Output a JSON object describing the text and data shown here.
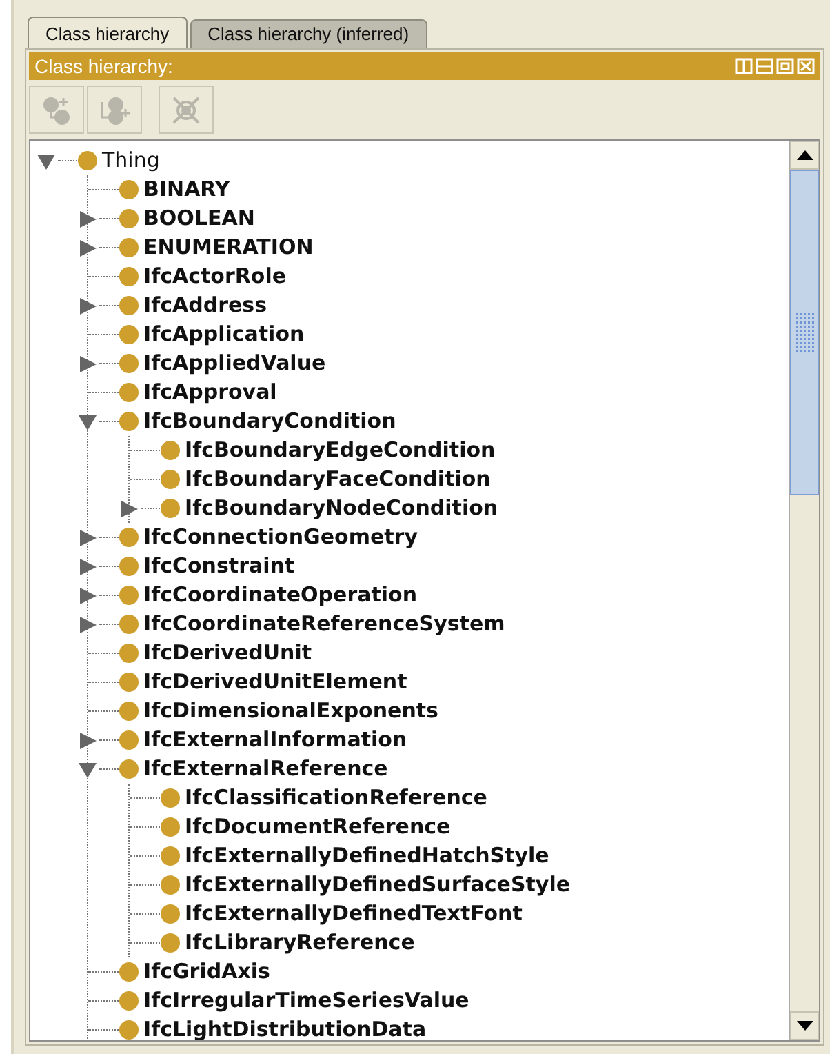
{
  "tabs": [
    {
      "label": "Class hierarchy",
      "selected": true
    },
    {
      "label": "Class hierarchy (inferred)",
      "selected": false
    }
  ],
  "panel": {
    "title": "Class hierarchy:"
  },
  "toolbar": [
    {
      "kind": "add-subclass",
      "disabled": true
    },
    {
      "kind": "add-sibling",
      "disabled": true
    },
    {
      "kind": "delete",
      "disabled": true
    }
  ],
  "tree": [
    {
      "label": "Thing",
      "bold": false,
      "kind": "expanded",
      "children": [
        {
          "label": "BINARY",
          "bold": true,
          "kind": "leaf"
        },
        {
          "label": "BOOLEAN",
          "bold": true,
          "kind": "collapsed"
        },
        {
          "label": "ENUMERATION",
          "bold": true,
          "kind": "collapsed"
        },
        {
          "label": "IfcActorRole",
          "bold": true,
          "kind": "leaf"
        },
        {
          "label": "IfcAddress",
          "bold": true,
          "kind": "collapsed"
        },
        {
          "label": "IfcApplication",
          "bold": true,
          "kind": "leaf"
        },
        {
          "label": "IfcAppliedValue",
          "bold": true,
          "kind": "collapsed"
        },
        {
          "label": "IfcApproval",
          "bold": true,
          "kind": "leaf"
        },
        {
          "label": "IfcBoundaryCondition",
          "bold": true,
          "kind": "expanded",
          "children": [
            {
              "label": "IfcBoundaryEdgeCondition",
              "bold": true,
              "kind": "leaf"
            },
            {
              "label": "IfcBoundaryFaceCondition",
              "bold": true,
              "kind": "leaf"
            },
            {
              "label": "IfcBoundaryNodeCondition",
              "bold": true,
              "kind": "collapsed"
            }
          ]
        },
        {
          "label": "IfcConnectionGeometry",
          "bold": true,
          "kind": "collapsed"
        },
        {
          "label": "IfcConstraint",
          "bold": true,
          "kind": "collapsed"
        },
        {
          "label": "IfcCoordinateOperation",
          "bold": true,
          "kind": "collapsed"
        },
        {
          "label": "IfcCoordinateReferenceSystem",
          "bold": true,
          "kind": "collapsed"
        },
        {
          "label": "IfcDerivedUnit",
          "bold": true,
          "kind": "leaf"
        },
        {
          "label": "IfcDerivedUnitElement",
          "bold": true,
          "kind": "leaf"
        },
        {
          "label": "IfcDimensionalExponents",
          "bold": true,
          "kind": "leaf"
        },
        {
          "label": "IfcExternalInformation",
          "bold": true,
          "kind": "collapsed"
        },
        {
          "label": "IfcExternalReference",
          "bold": true,
          "kind": "expanded",
          "children": [
            {
              "label": "IfcClassificationReference",
              "bold": true,
              "kind": "leaf"
            },
            {
              "label": "IfcDocumentReference",
              "bold": true,
              "kind": "leaf"
            },
            {
              "label": "IfcExternallyDefinedHatchStyle",
              "bold": true,
              "kind": "leaf"
            },
            {
              "label": "IfcExternallyDefinedSurfaceStyle",
              "bold": true,
              "kind": "leaf"
            },
            {
              "label": "IfcExternallyDefinedTextFont",
              "bold": true,
              "kind": "leaf"
            },
            {
              "label": "IfcLibraryReference",
              "bold": true,
              "kind": "leaf"
            }
          ]
        },
        {
          "label": "IfcGridAxis",
          "bold": true,
          "kind": "leaf"
        },
        {
          "label": "IfcIrregularTimeSeriesValue",
          "bold": true,
          "kind": "leaf"
        },
        {
          "label": "IfcLightDistributionData",
          "bold": true,
          "kind": "leaf"
        }
      ]
    }
  ]
}
